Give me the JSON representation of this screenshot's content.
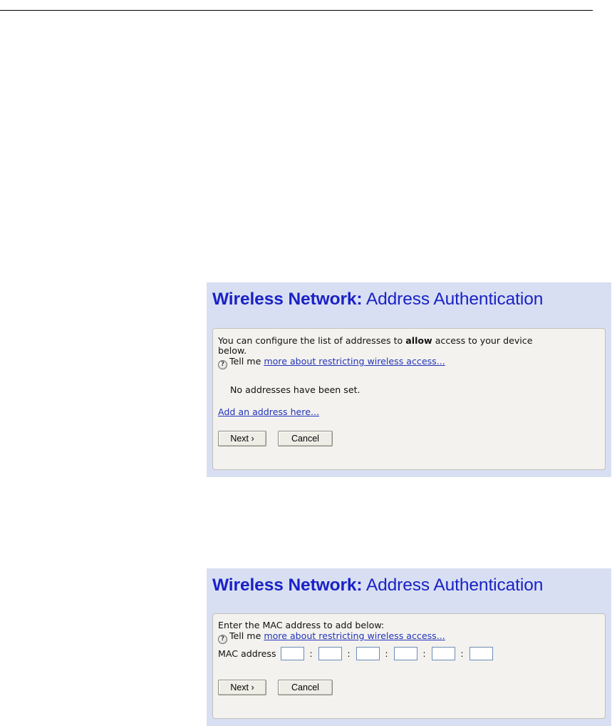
{
  "screen1": {
    "title_bold": "Wireless Network:",
    "title_rest": " Address Authentication",
    "intro_pre": "You can configure the list of addresses to ",
    "intro_bold": "allow",
    "intro_post": " access to your device",
    "intro_line2": "below.",
    "help_icon": "question-icon",
    "help_prefix": "Tell me ",
    "help_link": "more about restricting wireless access...",
    "status": "No addresses have been set.",
    "add_link": "Add an address here...",
    "next_label": "Next ›",
    "cancel_label": "Cancel"
  },
  "screen2": {
    "title_bold": "Wireless Network:",
    "title_rest": " Address Authentication",
    "instruction": "Enter the MAC address to add below:",
    "help_icon": "question-icon",
    "help_prefix": "Tell me ",
    "help_link": "more about restricting wireless access...",
    "mac_label": "MAC address",
    "mac_separator": ":",
    "mac_octets": [
      "",
      "",
      "",
      "",
      "",
      ""
    ],
    "next_label": "Next ›",
    "cancel_label": "Cancel"
  },
  "colors": {
    "title": "#1a22c6",
    "panel_bg": "#d8dff2",
    "form_bg": "#f3f2ef",
    "link": "#2334b8"
  }
}
